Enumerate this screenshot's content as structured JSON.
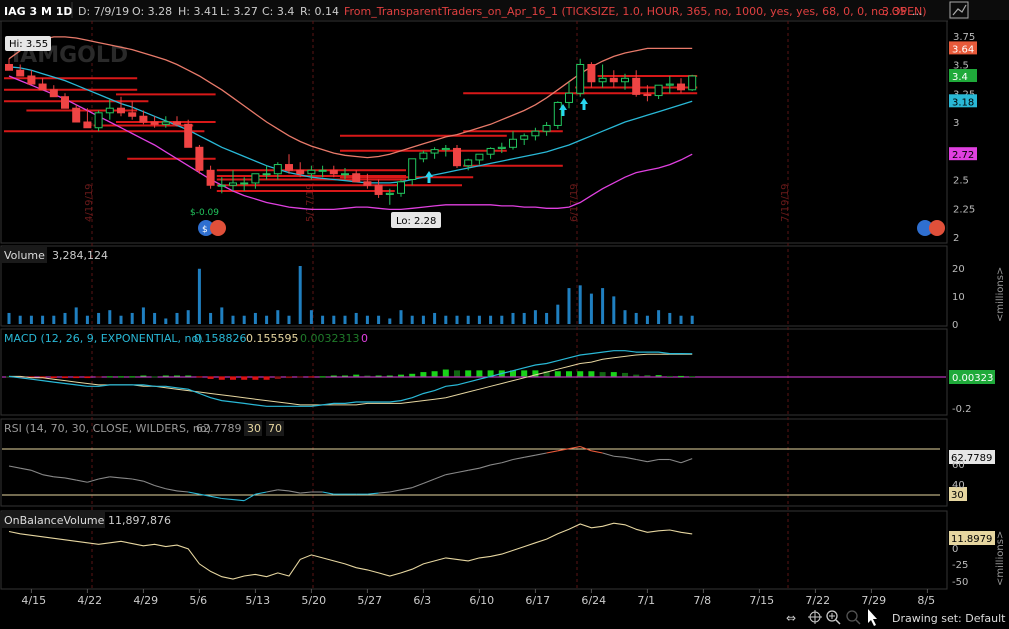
{
  "header": {
    "symbol": "IAG 3 M 1D",
    "date": "D: 7/9/19",
    "open": "O: 3.28",
    "high": "H: 3.41",
    "low": "L: 3.27",
    "close": "C: 3.4",
    "range": "R: 0.14",
    "study": "From_TransparentTraders_on_Apr_16_1 (TICKSIZE, 1.0, HOUR, 365, no, 1000, yes, yes, 68, 0, 0, no, OPEN)",
    "study_value": "3.35",
    "more": "..."
  },
  "colors": {
    "background": "#000000",
    "grid": "#222222",
    "up": "#22c55e",
    "down": "#ef4444",
    "band_upper": "#e87a6a",
    "band_mid": "#29b8d6",
    "band_lower": "#e040e0",
    "levels": "#d81818",
    "volume": "#1f7fc0",
    "macd": "#29b8d6",
    "signal": "#e6d6a0",
    "rsi": "#888888",
    "obv": "#e6d6a0",
    "header_text": "#e04040"
  },
  "price_panel": {
    "hi_label": "Hi: 3.55",
    "lo_label": "Lo: 2.28",
    "watermark": "IAMGOLD",
    "annotation": "$-0.09",
    "y_ticks": [
      "3.75",
      "3.5",
      "3.25",
      "3",
      "2.75",
      "2.5",
      "2.25",
      "2"
    ],
    "badges": [
      {
        "text": "3.64",
        "value": 3.64,
        "bg": "#e85a3a",
        "fg": "#ffffff"
      },
      {
        "text": "3.4",
        "value": 3.4,
        "bg": "#1faa3a",
        "fg": "#ffffff"
      },
      {
        "text": "3.18",
        "value": 3.18,
        "bg": "#29b8d6",
        "fg": "#000000"
      },
      {
        "text": "2.72",
        "value": 2.72,
        "bg": "#e040e0",
        "fg": "#000000"
      }
    ],
    "vertical_dates": [
      "4/19/19",
      "5/17/19",
      "6/17/19",
      "7/19/19"
    ]
  },
  "volume_panel": {
    "title": "Volume",
    "value": "3,284,124",
    "y_ticks": [
      "20",
      "10",
      "0"
    ],
    "unit": "<millions>"
  },
  "macd_panel": {
    "title": "MACD (12, 26, 9, EXPONENTIAL, no)",
    "macd": "0.158826",
    "signal": "0.155595",
    "diff": "0.0032313",
    "zero": "0",
    "badge": "0.00323",
    "y_ticks": [
      "-0.2"
    ]
  },
  "rsi_panel": {
    "title": "RSI (14, 70, 30, CLOSE, WILDERS, no)",
    "value": "62.7789",
    "oversold": "30",
    "overbought": "70",
    "badge": "62.7789",
    "badge2": "30",
    "y_ticks": [
      "60",
      "40"
    ]
  },
  "obv_panel": {
    "title": "OnBalanceVolume",
    "value": "11,897,876",
    "badge": "11.8979",
    "y_ticks": [
      "0",
      "-25",
      "-50"
    ],
    "unit": "<millions>"
  },
  "x_axis": [
    "4/15",
    "4/22",
    "4/29",
    "5/6",
    "5/13",
    "5/20",
    "5/27",
    "6/3",
    "6/10",
    "6/17",
    "6/24",
    "7/1",
    "7/8",
    "7/15",
    "7/22",
    "7/29",
    "8/5"
  ],
  "toolbar": {
    "drawing_set": "Drawing set: Default"
  },
  "chart_data": [
    {
      "type": "candlestick",
      "title": "IAG 3 M 1D",
      "ylim": [
        2.0,
        3.8
      ],
      "dates": [
        "4/11",
        "4/12",
        "4/15",
        "4/16",
        "4/17",
        "4/18",
        "4/19",
        "4/22",
        "4/23",
        "4/24",
        "4/25",
        "4/26",
        "4/29",
        "4/30",
        "5/1",
        "5/2",
        "5/3",
        "5/6",
        "5/7",
        "5/8",
        "5/9",
        "5/10",
        "5/13",
        "5/14",
        "5/15",
        "5/16",
        "5/17",
        "5/20",
        "5/21",
        "5/22",
        "5/23",
        "5/24",
        "5/28",
        "5/29",
        "5/30",
        "5/31",
        "6/3",
        "6/4",
        "6/5",
        "6/6",
        "6/7",
        "6/10",
        "6/11",
        "6/12",
        "6/13",
        "6/14",
        "6/17",
        "6/18",
        "6/19",
        "6/20",
        "6/21",
        "6/24",
        "6/25",
        "6/26",
        "6/27",
        "6/28",
        "7/1",
        "7/2",
        "7/3",
        "7/5",
        "7/8",
        "7/9"
      ],
      "open": [
        3.5,
        3.45,
        3.4,
        3.33,
        3.28,
        3.22,
        3.12,
        3.0,
        2.95,
        3.08,
        3.12,
        3.08,
        3.05,
        3.0,
        2.98,
        3.0,
        2.98,
        2.78,
        2.58,
        2.45,
        2.45,
        2.47,
        2.47,
        2.55,
        2.55,
        2.63,
        2.58,
        2.55,
        2.58,
        2.58,
        2.55,
        2.55,
        2.48,
        2.45,
        2.37,
        2.38,
        2.5,
        2.68,
        2.73,
        2.76,
        2.77,
        2.62,
        2.67,
        2.72,
        2.77,
        2.78,
        2.85,
        2.88,
        2.92,
        2.97,
        3.17,
        3.25,
        3.5,
        3.35,
        3.38,
        3.35,
        3.38,
        3.24,
        3.23,
        3.32,
        3.33,
        3.28
      ],
      "high": [
        3.55,
        3.5,
        3.45,
        3.38,
        3.32,
        3.25,
        3.15,
        3.12,
        3.1,
        3.2,
        3.22,
        3.18,
        3.1,
        3.05,
        3.05,
        3.05,
        3.02,
        2.8,
        2.62,
        2.52,
        2.58,
        2.52,
        2.52,
        2.62,
        2.65,
        2.72,
        2.65,
        2.62,
        2.62,
        2.62,
        2.6,
        2.58,
        2.55,
        2.5,
        2.42,
        2.5,
        2.55,
        2.75,
        2.78,
        2.8,
        2.8,
        2.68,
        2.72,
        2.78,
        2.82,
        2.92,
        2.9,
        2.95,
        3.0,
        3.18,
        3.35,
        3.55,
        3.52,
        3.5,
        3.45,
        3.42,
        3.45,
        3.32,
        3.32,
        3.4,
        3.38,
        3.41
      ],
      "low": [
        3.45,
        3.4,
        3.33,
        3.28,
        3.22,
        3.12,
        3.0,
        2.95,
        2.92,
        3.02,
        3.05,
        3.02,
        2.98,
        2.95,
        2.95,
        2.96,
        2.95,
        2.55,
        2.42,
        2.38,
        2.4,
        2.4,
        2.42,
        2.5,
        2.5,
        2.55,
        2.52,
        2.5,
        2.52,
        2.52,
        2.5,
        2.48,
        2.42,
        2.34,
        2.28,
        2.35,
        2.45,
        2.65,
        2.68,
        2.7,
        2.6,
        2.58,
        2.63,
        2.68,
        2.73,
        2.76,
        2.8,
        2.84,
        2.88,
        2.94,
        3.12,
        3.22,
        3.3,
        3.3,
        3.3,
        3.28,
        3.22,
        3.18,
        3.2,
        3.25,
        3.25,
        3.27
      ],
      "close": [
        3.45,
        3.4,
        3.33,
        3.28,
        3.22,
        3.12,
        3.0,
        2.95,
        3.08,
        3.12,
        3.08,
        3.05,
        3.0,
        2.98,
        3.0,
        2.98,
        2.78,
        2.58,
        2.45,
        2.45,
        2.47,
        2.47,
        2.55,
        2.55,
        2.63,
        2.58,
        2.55,
        2.58,
        2.58,
        2.55,
        2.55,
        2.48,
        2.45,
        2.37,
        2.38,
        2.48,
        2.68,
        2.73,
        2.76,
        2.77,
        2.62,
        2.67,
        2.72,
        2.77,
        2.78,
        2.85,
        2.88,
        2.92,
        2.97,
        3.17,
        3.25,
        3.5,
        3.35,
        3.38,
        3.35,
        3.38,
        3.24,
        3.23,
        3.32,
        3.33,
        3.28,
        3.4
      ],
      "band_upper": [
        3.55,
        3.62,
        3.68,
        3.72,
        3.74,
        3.74,
        3.73,
        3.71,
        3.69,
        3.67,
        3.65,
        3.63,
        3.6,
        3.57,
        3.54,
        3.5,
        3.45,
        3.4,
        3.34,
        3.28,
        3.21,
        3.14,
        3.07,
        3.0,
        2.94,
        2.88,
        2.83,
        2.79,
        2.76,
        2.73,
        2.71,
        2.7,
        2.69,
        2.7,
        2.72,
        2.75,
        2.78,
        2.81,
        2.84,
        2.87,
        2.89,
        2.92,
        2.95,
        2.98,
        3.02,
        3.06,
        3.1,
        3.15,
        3.21,
        3.28,
        3.35,
        3.42,
        3.48,
        3.53,
        3.57,
        3.6,
        3.62,
        3.64,
        3.64,
        3.64,
        3.64,
        3.64
      ],
      "band_mid": [
        3.48,
        3.47,
        3.45,
        3.42,
        3.39,
        3.36,
        3.32,
        3.28,
        3.24,
        3.2,
        3.16,
        3.13,
        3.09,
        3.05,
        3.01,
        2.97,
        2.93,
        2.88,
        2.83,
        2.78,
        2.74,
        2.7,
        2.66,
        2.62,
        2.59,
        2.56,
        2.54,
        2.52,
        2.51,
        2.5,
        2.49,
        2.48,
        2.47,
        2.47,
        2.47,
        2.48,
        2.5,
        2.52,
        2.54,
        2.56,
        2.58,
        2.6,
        2.62,
        2.64,
        2.66,
        2.68,
        2.7,
        2.72,
        2.74,
        2.77,
        2.8,
        2.84,
        2.88,
        2.92,
        2.96,
        3.0,
        3.03,
        3.06,
        3.09,
        3.12,
        3.15,
        3.18
      ],
      "band_lower": [
        3.4,
        3.36,
        3.32,
        3.28,
        3.24,
        3.2,
        3.15,
        3.1,
        3.05,
        3.0,
        2.95,
        2.9,
        2.85,
        2.8,
        2.74,
        2.68,
        2.62,
        2.56,
        2.5,
        2.45,
        2.4,
        2.36,
        2.33,
        2.3,
        2.28,
        2.26,
        2.25,
        2.24,
        2.24,
        2.24,
        2.25,
        2.26,
        2.26,
        2.25,
        2.24,
        2.24,
        2.25,
        2.26,
        2.27,
        2.28,
        2.28,
        2.28,
        2.28,
        2.28,
        2.27,
        2.27,
        2.26,
        2.26,
        2.25,
        2.25,
        2.26,
        2.3,
        2.36,
        2.42,
        2.47,
        2.52,
        2.56,
        2.58,
        2.6,
        2.63,
        2.67,
        2.72
      ],
      "levels": [
        {
          "y": 3.38,
          "from": "4/11",
          "to": "4/26"
        },
        {
          "y": 3.28,
          "from": "4/11",
          "to": "4/26"
        },
        {
          "y": 3.18,
          "from": "4/11",
          "to": "4/29"
        },
        {
          "y": 3.1,
          "from": "4/15",
          "to": "4/26"
        },
        {
          "y": 2.92,
          "from": "4/11",
          "to": "5/6"
        },
        {
          "y": 3.24,
          "from": "4/25",
          "to": "5/7"
        },
        {
          "y": 3.0,
          "from": "4/25",
          "to": "5/7"
        },
        {
          "y": 2.97,
          "from": "4/23",
          "to": "5/3"
        },
        {
          "y": 2.68,
          "from": "4/26",
          "to": "5/7"
        },
        {
          "y": 2.58,
          "from": "5/8",
          "to": "5/31"
        },
        {
          "y": 2.53,
          "from": "5/8",
          "to": "5/31"
        },
        {
          "y": 2.5,
          "from": "5/8",
          "to": "5/31"
        },
        {
          "y": 2.45,
          "from": "5/8",
          "to": "6/7"
        },
        {
          "y": 2.4,
          "from": "5/8",
          "to": "5/30"
        },
        {
          "y": 2.88,
          "from": "5/23",
          "to": "6/13"
        },
        {
          "y": 2.75,
          "from": "5/23",
          "to": "6/13"
        },
        {
          "y": 2.52,
          "from": "5/23",
          "to": "6/10"
        },
        {
          "y": 3.25,
          "from": "6/10",
          "to": "6/24"
        },
        {
          "y": 2.92,
          "from": "6/10",
          "to": "6/20"
        },
        {
          "y": 2.62,
          "from": "6/10",
          "to": "6/20"
        },
        {
          "y": 3.4,
          "from": "6/26",
          "to": "7/9"
        },
        {
          "y": 3.3,
          "from": "6/24",
          "to": "7/9"
        },
        {
          "y": 3.25,
          "from": "6/24",
          "to": "7/9"
        }
      ]
    },
    {
      "type": "bar",
      "title": "Volume",
      "ylim": [
        0,
        21
      ],
      "unit": "millions",
      "values": [
        4,
        3,
        3,
        3,
        3,
        4,
        6,
        3,
        4,
        5,
        3,
        4,
        6,
        4,
        2,
        4,
        5,
        20,
        4,
        6,
        3,
        3,
        4,
        3,
        5,
        3,
        21,
        5,
        3,
        3,
        3,
        4,
        3,
        3,
        2,
        5,
        3,
        3,
        4,
        3,
        3,
        3,
        3,
        3,
        3,
        4,
        4,
        5,
        4,
        7,
        13,
        14,
        11,
        13,
        10,
        5,
        4,
        3,
        5,
        4,
        3,
        3
      ]
    },
    {
      "type": "line",
      "title": "MACD (12, 26, 9, EXPONENTIAL, no)",
      "ylim": [
        -0.25,
        0.22
      ],
      "series": [
        {
          "name": "MACD",
          "values": [
            0.0,
            -0.01,
            -0.02,
            -0.03,
            -0.04,
            -0.05,
            -0.06,
            -0.07,
            -0.07,
            -0.06,
            -0.06,
            -0.06,
            -0.06,
            -0.07,
            -0.07,
            -0.08,
            -0.09,
            -0.12,
            -0.15,
            -0.17,
            -0.18,
            -0.19,
            -0.2,
            -0.21,
            -0.21,
            -0.21,
            -0.21,
            -0.21,
            -0.2,
            -0.19,
            -0.19,
            -0.18,
            -0.18,
            -0.18,
            -0.18,
            -0.17,
            -0.15,
            -0.12,
            -0.1,
            -0.07,
            -0.06,
            -0.04,
            -0.02,
            0.0,
            0.02,
            0.04,
            0.06,
            0.08,
            0.09,
            0.11,
            0.13,
            0.15,
            0.16,
            0.17,
            0.18,
            0.18,
            0.17,
            0.17,
            0.17,
            0.16,
            0.16,
            0.158826
          ]
        },
        {
          "name": "Signal",
          "values": [
            0.0,
            0.0,
            -0.01,
            -0.01,
            -0.02,
            -0.03,
            -0.04,
            -0.05,
            -0.06,
            -0.06,
            -0.06,
            -0.06,
            -0.07,
            -0.07,
            -0.08,
            -0.09,
            -0.1,
            -0.11,
            -0.12,
            -0.13,
            -0.14,
            -0.15,
            -0.16,
            -0.17,
            -0.18,
            -0.19,
            -0.2,
            -0.2,
            -0.2,
            -0.2,
            -0.2,
            -0.2,
            -0.19,
            -0.19,
            -0.19,
            -0.19,
            -0.18,
            -0.17,
            -0.16,
            -0.15,
            -0.13,
            -0.11,
            -0.09,
            -0.07,
            -0.05,
            -0.03,
            -0.01,
            0.01,
            0.03,
            0.05,
            0.07,
            0.09,
            0.1,
            0.12,
            0.13,
            0.14,
            0.15,
            0.155,
            0.155,
            0.155,
            0.155,
            0.155595
          ]
        },
        {
          "name": "Diff",
          "values": [
            0.0,
            -0.01,
            -0.01,
            -0.02,
            -0.02,
            -0.02,
            -0.02,
            -0.02,
            -0.01,
            0.0,
            0.0,
            0.0,
            0.01,
            0.0,
            0.01,
            0.01,
            0.01,
            -0.01,
            -0.03,
            -0.04,
            -0.04,
            -0.04,
            -0.04,
            -0.04,
            -0.03,
            -0.02,
            -0.01,
            -0.01,
            0.0,
            0.01,
            0.01,
            0.02,
            0.01,
            0.01,
            0.01,
            0.02,
            0.03,
            0.05,
            0.06,
            0.08,
            0.07,
            0.07,
            0.07,
            0.07,
            0.07,
            0.07,
            0.07,
            0.07,
            0.06,
            0.06,
            0.06,
            0.06,
            0.06,
            0.05,
            0.05,
            0.04,
            0.02,
            0.015,
            0.015,
            0.005,
            0.005,
            0.0032313
          ]
        }
      ]
    },
    {
      "type": "line",
      "title": "RSI (14, 70, 30, CLOSE, WILDERS, no)",
      "ylim": [
        20,
        80
      ],
      "levels": [
        70,
        30
      ],
      "values": [
        56,
        54,
        52,
        48,
        46,
        45,
        43,
        41,
        44,
        46,
        45,
        44,
        42,
        38,
        35,
        33,
        32,
        30,
        28,
        26,
        25,
        24,
        30,
        32,
        34,
        33,
        31,
        32,
        32,
        30,
        30,
        30,
        30,
        31,
        32,
        34,
        36,
        40,
        44,
        48,
        50,
        52,
        54,
        57,
        59,
        62,
        64,
        66,
        68,
        70,
        72,
        74,
        70,
        68,
        65,
        64,
        62,
        60,
        62,
        62,
        59,
        62.7789
      ]
    },
    {
      "type": "line",
      "title": "OnBalanceVolume",
      "ylim": [
        -60,
        25
      ],
      "unit": "millions",
      "values": [
        15,
        12,
        10,
        8,
        6,
        4,
        2,
        0,
        -2,
        0,
        2,
        -1,
        -4,
        -2,
        -5,
        -3,
        -8,
        -28,
        -38,
        -45,
        -48,
        -44,
        -42,
        -45,
        -40,
        -44,
        -22,
        -16,
        -20,
        -24,
        -28,
        -33,
        -36,
        -40,
        -44,
        -40,
        -35,
        -28,
        -24,
        -20,
        -22,
        -24,
        -20,
        -18,
        -15,
        -10,
        -5,
        0,
        5,
        12,
        18,
        25,
        20,
        22,
        26,
        24,
        18,
        14,
        16,
        17,
        14,
        11.8979
      ]
    }
  ]
}
